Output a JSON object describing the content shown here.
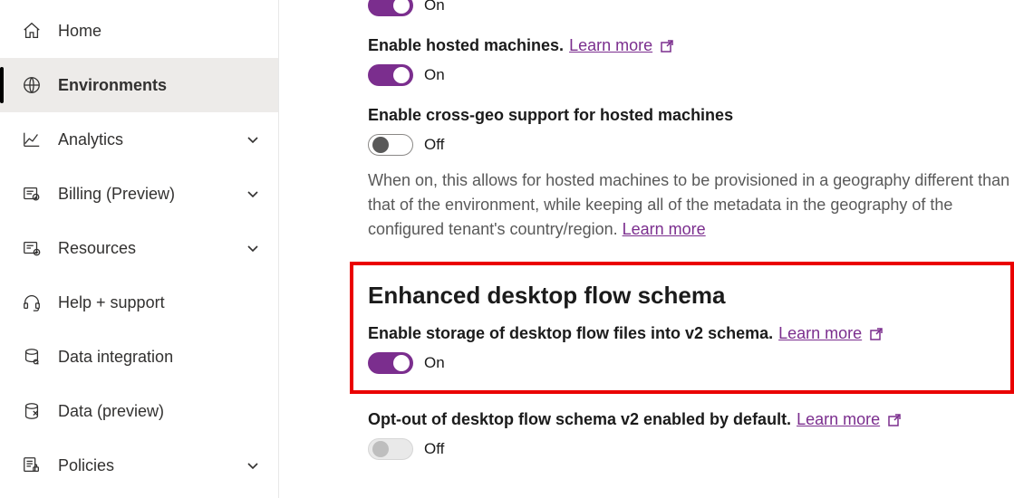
{
  "sidebar": {
    "items": [
      {
        "label": "Home"
      },
      {
        "label": "Environments"
      },
      {
        "label": "Analytics"
      },
      {
        "label": "Billing (Preview)"
      },
      {
        "label": "Resources"
      },
      {
        "label": "Help + support"
      },
      {
        "label": "Data integration"
      },
      {
        "label": "Data (preview)"
      },
      {
        "label": "Policies"
      }
    ]
  },
  "main": {
    "setting0": {
      "state": "On"
    },
    "setting1": {
      "label": "Enable hosted machines.",
      "learn_more": "Learn more",
      "state": "On"
    },
    "setting2": {
      "label": "Enable cross-geo support for hosted machines",
      "state": "Off",
      "description": "When on, this allows for hosted machines to be provisioned in a geography different than that of the environment, while keeping all of the metadata in the geography of the configured tenant's country/region.",
      "description_link": "Learn more"
    },
    "section": {
      "title": "Enhanced desktop flow schema",
      "setting_a": {
        "label": "Enable storage of desktop flow files into v2 schema.",
        "learn_more": "Learn more",
        "state": "On"
      },
      "setting_b": {
        "label": "Opt-out of desktop flow schema v2 enabled by default.",
        "learn_more": "Learn more",
        "state": "Off"
      }
    }
  }
}
